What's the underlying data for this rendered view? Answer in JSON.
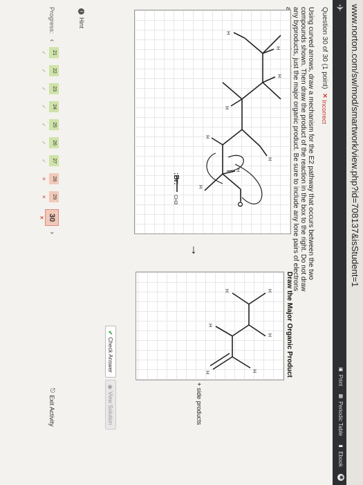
{
  "browser": {
    "url": "www.norton.com/sw/mod/smartwork/view.php?id=708137&isStudent=1"
  },
  "toolbar": {
    "print": "Print",
    "periodic_table": "Periodic Table",
    "ebook": "Ebook"
  },
  "question": {
    "header": "Question 30 of 30 (1 point)",
    "status": "Incorrect",
    "instructions": "Using curved arrows, draw a mechanism for the E2 pathway that occurs between the two compounds shown. Then draw the product of the reaction in the box to the right. Do not draw any byproducts, just the major organic product. Be sure to include any lone pairs of electrons and nonzero formal charges."
  },
  "left_panel": {
    "ch3_label": "CH3",
    "o_label": "O",
    "h_label": "H"
  },
  "right_panel": {
    "title": "Draw the Major Organic Product",
    "h_label": "H",
    "side_products": "+ side products"
  },
  "actions": {
    "check_answer": "Check Answer",
    "view_solution": "View Solution",
    "hint": "Hint",
    "exit": "Exit Activity"
  },
  "progress": {
    "label": "Progress:",
    "items": [
      {
        "num": "21",
        "mark": "✓",
        "state": "ok"
      },
      {
        "num": "22",
        "mark": "✓",
        "state": "ok"
      },
      {
        "num": "23",
        "mark": "✓",
        "state": "ok"
      },
      {
        "num": "24",
        "mark": "✓",
        "state": "ok"
      },
      {
        "num": "25",
        "mark": "✓",
        "state": "ok"
      },
      {
        "num": "26",
        "mark": "✓",
        "state": "ok"
      },
      {
        "num": "27",
        "mark": "✓",
        "state": "ok"
      },
      {
        "num": "28",
        "mark": "✕",
        "state": "bad"
      },
      {
        "num": "29",
        "mark": "✕",
        "state": "bad"
      },
      {
        "num": "30",
        "mark": "✕",
        "state": "cur"
      }
    ]
  },
  "colors": {
    "correct": "#cfe3a8",
    "incorrect": "#f1c9b8",
    "check": "#2e9b3c",
    "toolbar": "#2d2f33"
  }
}
